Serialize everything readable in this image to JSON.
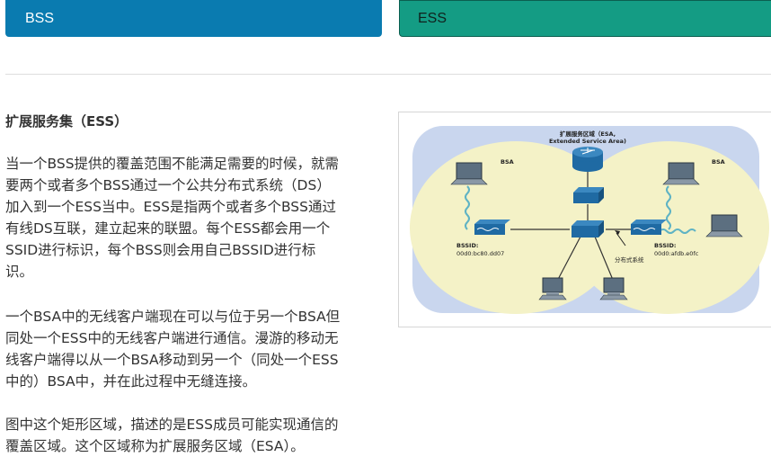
{
  "tabs": [
    {
      "label": "BSS",
      "active": false,
      "color": "#0a7bb0"
    },
    {
      "label": "ESS",
      "active": true,
      "color": "#149c84"
    }
  ],
  "content": {
    "heading": "扩展服务集（ESS）",
    "paragraphs": [
      "当一个BSS提供的覆盖范围不能满足需要的时候，就需\n要两个或者多个BSS通过一个公共分布式系统（DS）\n加入到一个ESS当中。ESS是指两个或者多个BSS通过\n有线DS互联，建立起来的联盟。每个ESS都会用一个\nSSID进行标识，每个BSS则会用自己BSSID进行标\n识。",
      "一个BSA中的无线客户端现在可以与位于另一个BSA但\n同处一个ESS中的无线客户端进行通信。漫游的移动无\n线客户端得以从一个BSA移动到另一个（同处一个ESS\n中的）BSA中，并在此过程中无缝连接。",
      "图中这个矩形区域，描述的是ESS成员可能实现通信的\n覆盖区域。这个区域称为扩展服务区域（ESA）。"
    ]
  },
  "diagram": {
    "esa_title_line1": "扩展服务区域（ESA,",
    "esa_title_line2": "Extended Service Area)",
    "bsa_left": "BSA",
    "bsa_right": "BSA",
    "bssid_label": "BSSID:",
    "bssid_left_value": "00d0:bc80.dd07",
    "bssid_right_label": "BSSID:",
    "bssid_right_value": "00d0:afdb.e0fc",
    "ds_label": "分布式系统",
    "colors": {
      "esa_area": "#c9d6ee",
      "bsa_area": "#f4f2c7",
      "device": "#1f6aa3"
    }
  }
}
